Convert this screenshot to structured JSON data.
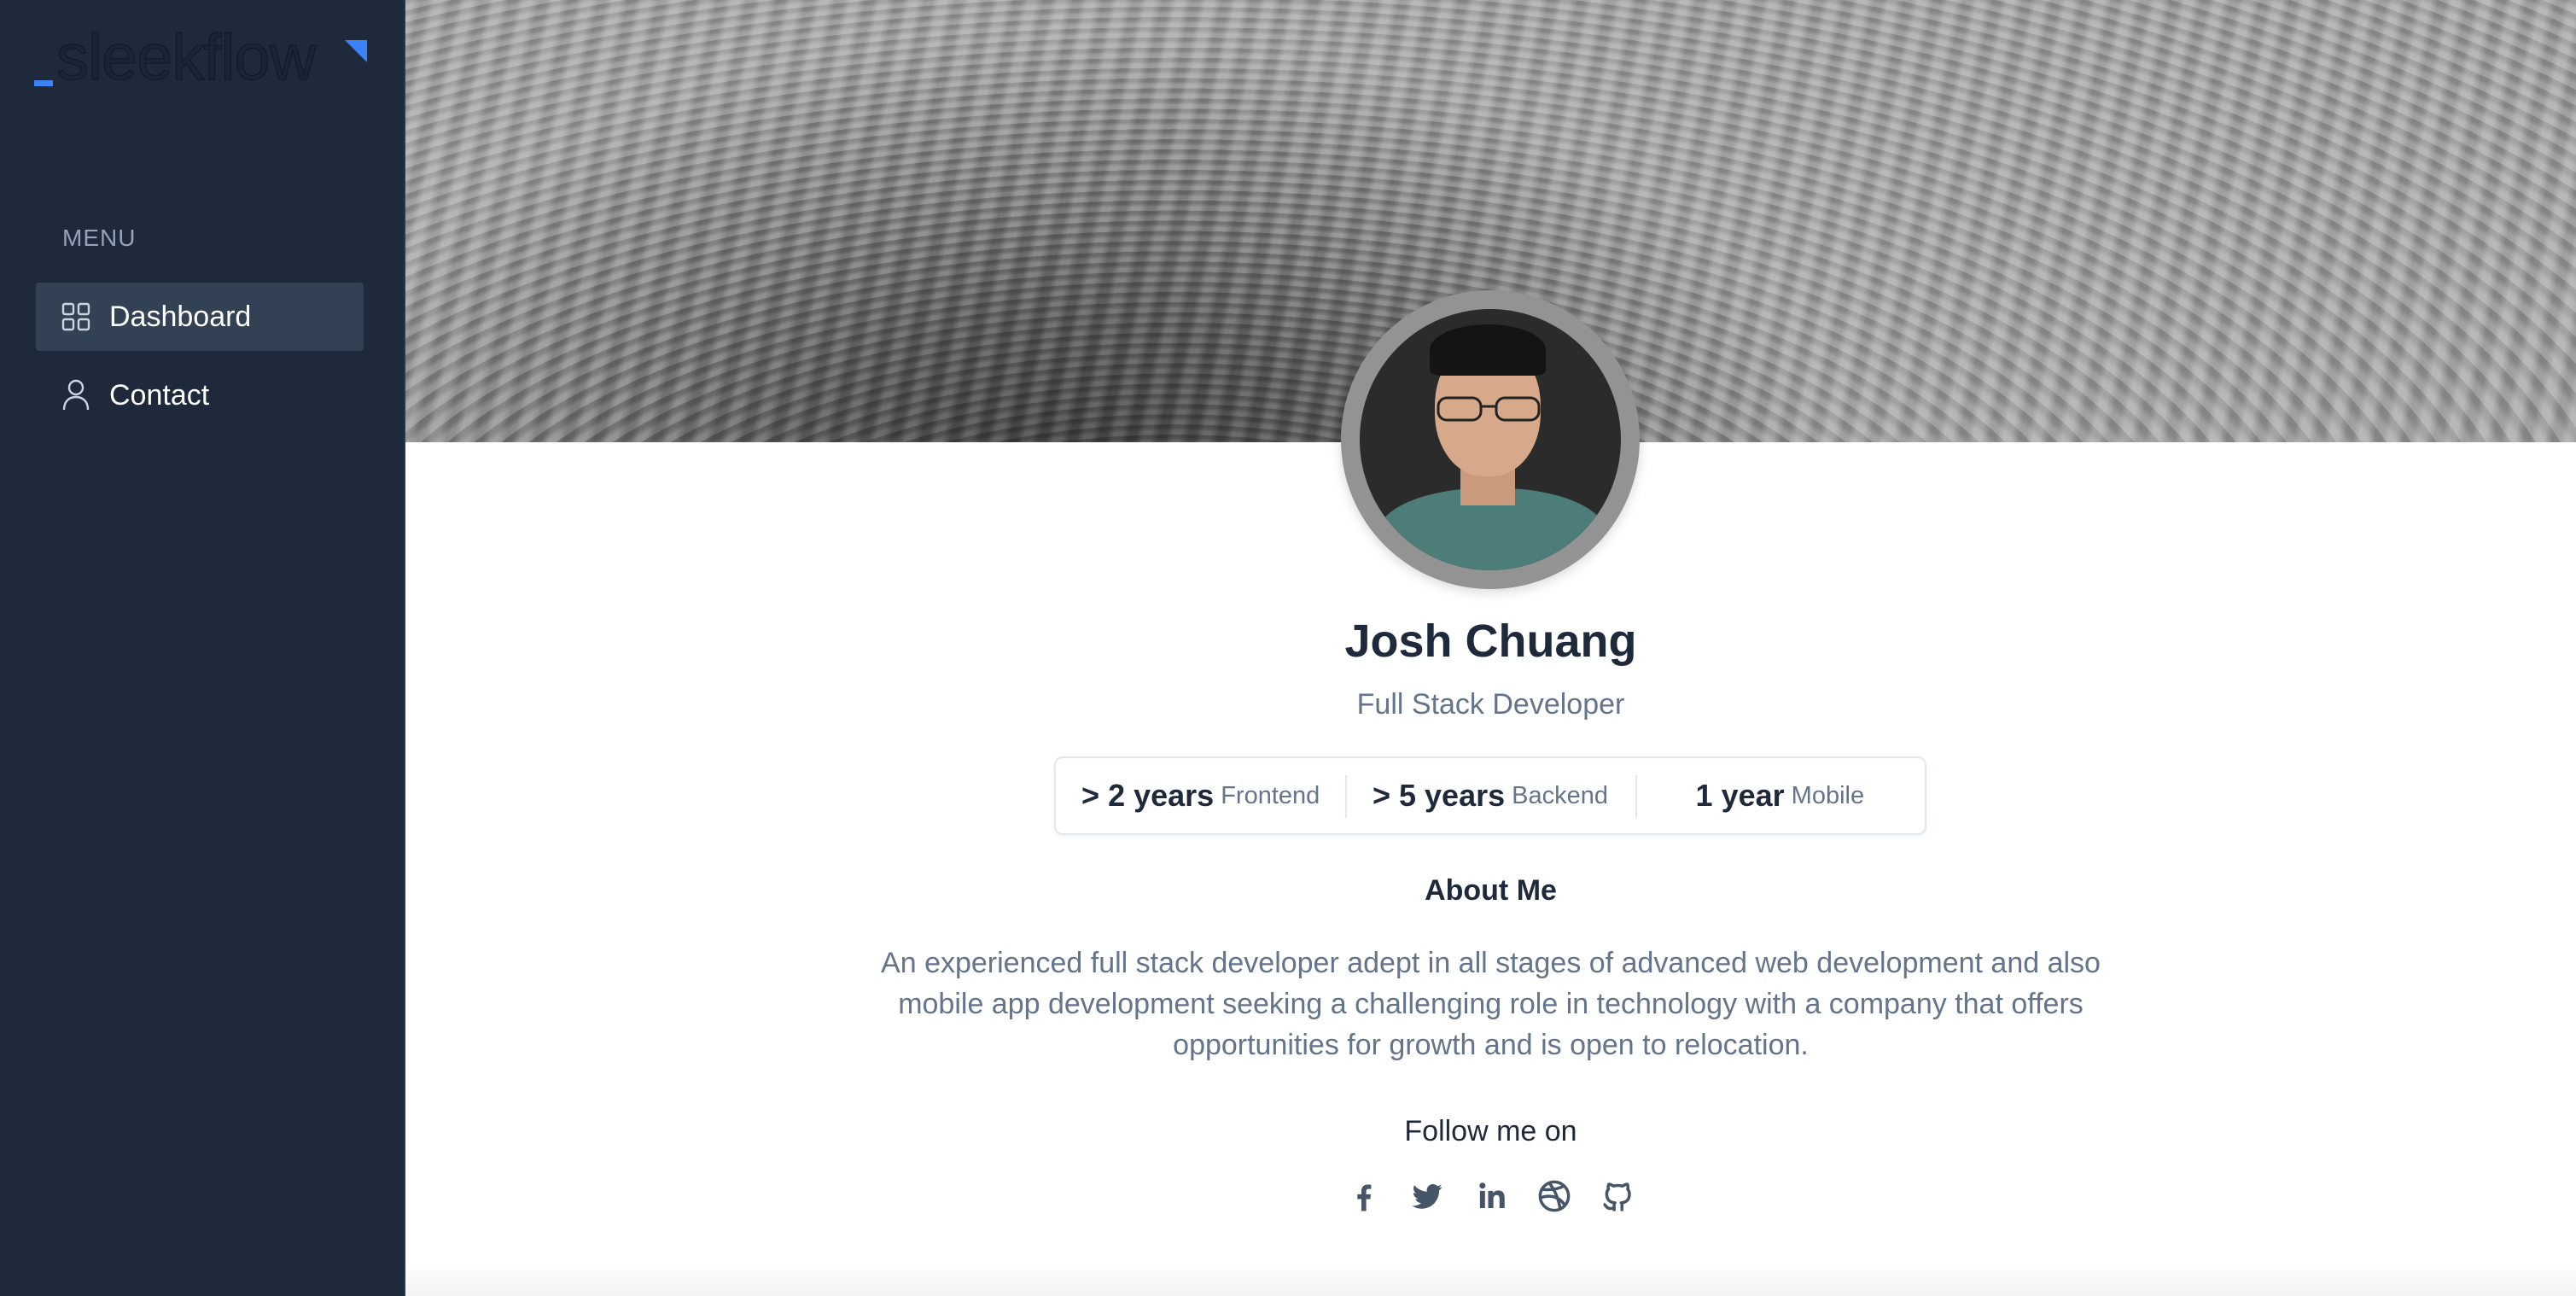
{
  "brand": {
    "name": "sleekflow",
    "accent": "#3b82f6"
  },
  "sidebar": {
    "menu_label": "MENU",
    "items": [
      {
        "label": "Dashboard",
        "icon": "grid-icon",
        "active": true
      },
      {
        "label": "Contact",
        "icon": "user-icon",
        "active": false
      }
    ],
    "background": "#1e293b"
  },
  "profile": {
    "name": "Josh Chuang",
    "title": "Full Stack Developer",
    "stats": [
      {
        "value": "> 2 years",
        "label": "Frontend"
      },
      {
        "value": "> 5 years",
        "label": "Backend"
      },
      {
        "value": "1 year",
        "label": "Mobile"
      }
    ],
    "about_heading": "About Me",
    "about_text": "An experienced full stack developer adept in all stages of advanced web development and also mobile app development seeking a challenging role in technology with a company that offers opportunities for growth and is open to relocation.",
    "follow_heading": "Follow me on",
    "socials": [
      "facebook-icon",
      "twitter-icon",
      "linkedin-icon",
      "dribbble-icon",
      "github-icon"
    ]
  }
}
